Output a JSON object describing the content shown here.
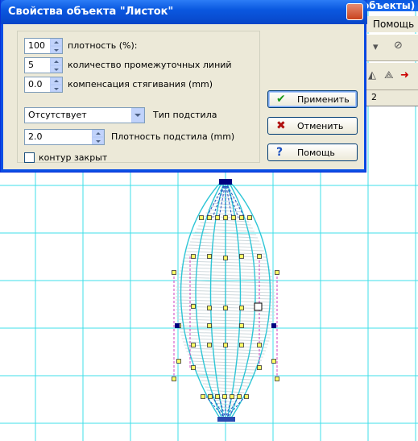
{
  "app": {
    "title_fragment": "объекты)",
    "menu_help": "Помощь",
    "ruler_tick": "2"
  },
  "dialog": {
    "title": "Свойства объекта \"Листок\"",
    "fields": {
      "density_value": "100",
      "density_label": "плотность (%):",
      "lines_value": "5",
      "lines_label": "количество промежуточных линий",
      "compensation_value": "0.0",
      "compensation_label": "компенсация стягивания (mm)",
      "underlay_type_value": "Отсутствует",
      "underlay_type_label": "Тип подстила",
      "underlay_density_value": "2.0",
      "underlay_density_label": "Плотность подстила (mm)",
      "closed_contour_label": "контур закрыт",
      "closed_contour_checked": false
    },
    "buttons": {
      "apply": "Применить",
      "cancel": "Отменить",
      "help": "Помощь"
    }
  },
  "colors": {
    "grid": "#3fdfe8",
    "stitch": "#2ec6d6",
    "node_fill": "#ffff66",
    "node_dark": "#000080",
    "guide_pink": "#d040c0",
    "xp_blue": "#0a58e0"
  },
  "icons": [
    "check-icon",
    "x-icon",
    "question-icon",
    "close-icon"
  ]
}
